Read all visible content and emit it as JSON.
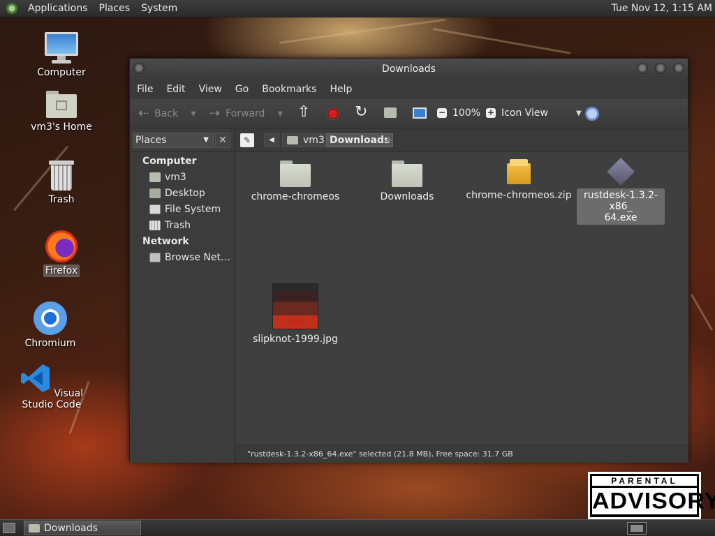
{
  "top_panel": {
    "menus": [
      "Applications",
      "Places",
      "System"
    ],
    "clock": "Tue Nov 12,  1:15 AM"
  },
  "desktop_icons": [
    {
      "label": "Computer",
      "icon": "computer-icon"
    },
    {
      "label": "vm3's Home",
      "icon": "home-folder-icon"
    },
    {
      "label": "Trash",
      "icon": "trash-icon"
    },
    {
      "label": "Firefox",
      "icon": "firefox-icon"
    },
    {
      "label": "Chromium",
      "icon": "chromium-icon"
    },
    {
      "label": "Visual Studio Code",
      "icon": "vscode-icon"
    }
  ],
  "window": {
    "title": "Downloads",
    "menu": [
      "File",
      "Edit",
      "View",
      "Go",
      "Bookmarks",
      "Help"
    ],
    "toolbar": {
      "back": "Back",
      "forward": "Forward",
      "zoom": "100%",
      "view_mode": "Icon View"
    },
    "sidebar": {
      "selector": "Places",
      "sections": [
        {
          "heading": "Computer",
          "items": [
            "vm3",
            "Desktop",
            "File System",
            "Trash"
          ]
        },
        {
          "heading": "Network",
          "items": [
            "Browse Net…"
          ]
        }
      ]
    },
    "pathbar": {
      "crumbs": [
        "vm3",
        "Downloads"
      ]
    },
    "files": [
      {
        "name": "chrome-chromeos",
        "type": "folder"
      },
      {
        "name": "Downloads",
        "type": "folder"
      },
      {
        "name": "chrome-chromeos.zip",
        "type": "zip"
      },
      {
        "name": "rustdesk-1.3.2-x86_64.exe",
        "line1": "rustdesk-1.3.2-x86_",
        "line2": "64.exe",
        "type": "exe",
        "selected": true
      },
      {
        "name": "slipknot-1999.jpg",
        "type": "image"
      }
    ],
    "status": "\"rustdesk-1.3.2-x86_64.exe\" selected (21.8 MB), Free space: 31.7 GB"
  },
  "taskbar": {
    "task": "Downloads"
  },
  "wallpaper_badge": {
    "line1": "PARENTAL",
    "line2": "ADVISORY"
  },
  "colors": {
    "panel": "#2b2b2b",
    "window_bg": "#3f3f3f",
    "selection": "#6c6c6c"
  }
}
